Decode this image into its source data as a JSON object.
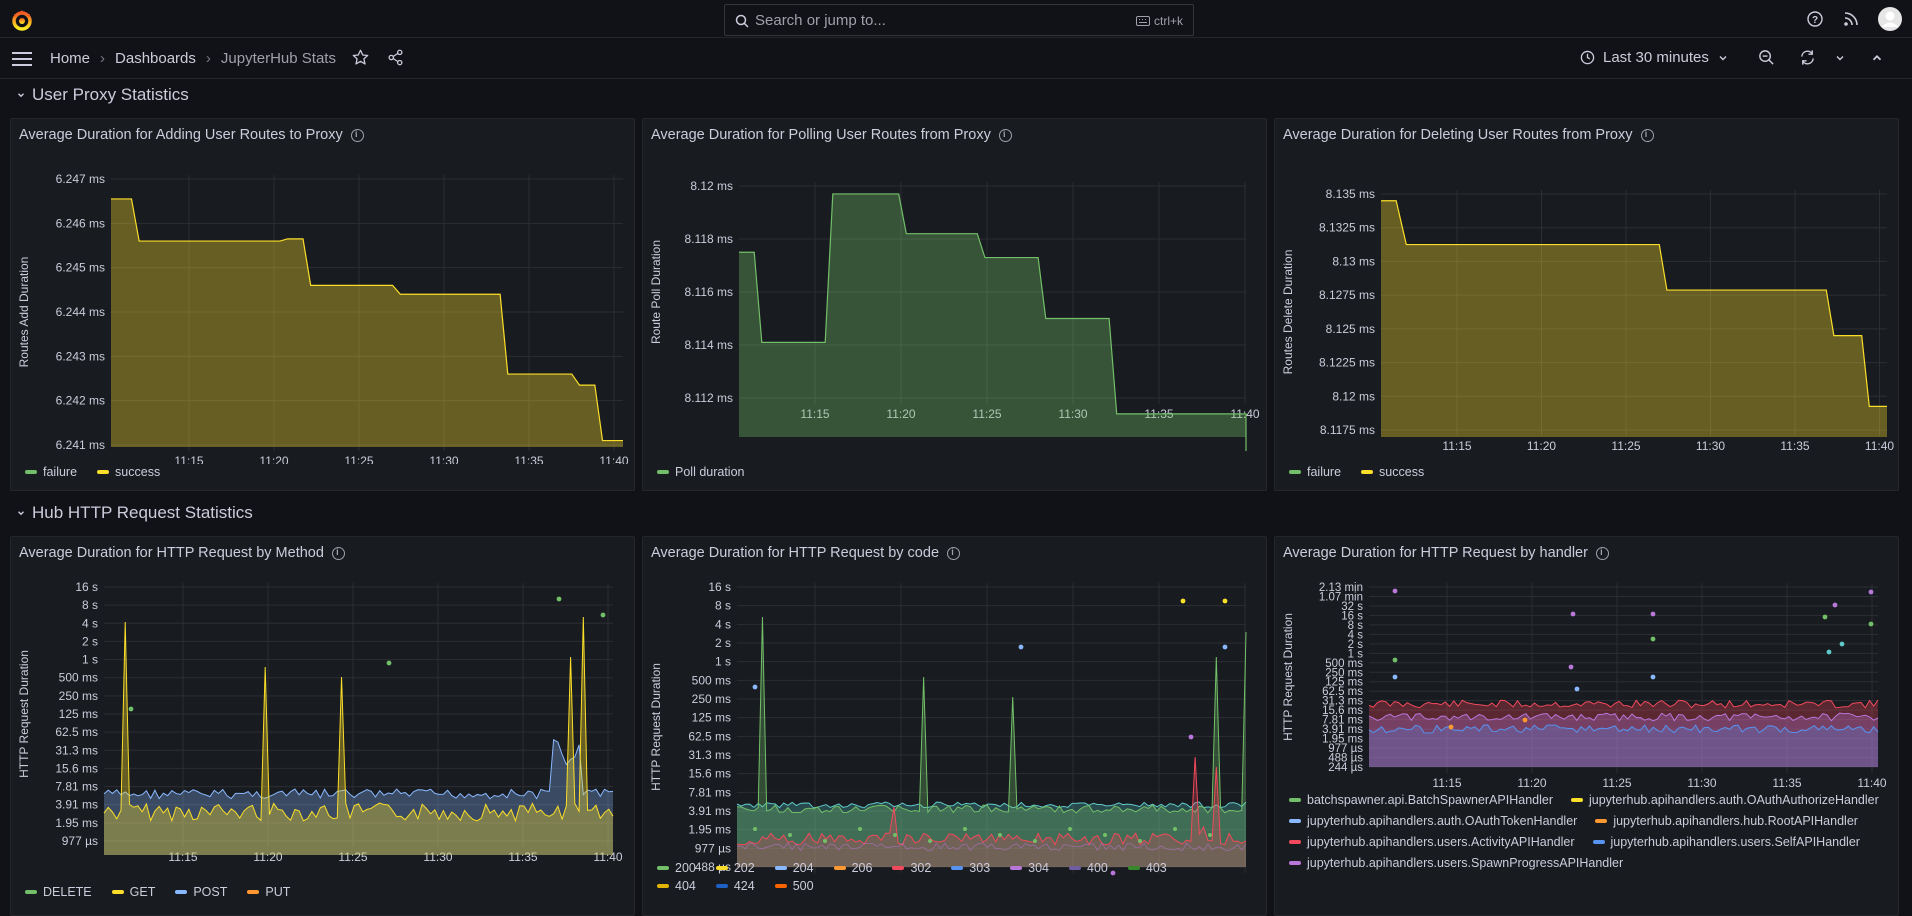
{
  "search": {
    "placeholder": "Search or jump to...",
    "shortcut": "ctrl+k"
  },
  "breadcrumb": [
    "Home",
    "Dashboards",
    "JupyterHub Stats"
  ],
  "timepicker": {
    "label": "Last 30 minutes"
  },
  "rows": {
    "proxy": "User Proxy Statistics",
    "http": "Hub HTTP Request Statistics"
  },
  "xticks": [
    "11:15",
    "11:20",
    "11:25",
    "11:30",
    "11:35",
    "11:40"
  ],
  "colors": {
    "green": "#73bf69",
    "yellow": "#fade2a",
    "blue": "#8ab8ff",
    "orange": "#ff9830",
    "red": "#f2495c",
    "blue2": "#5794f2",
    "purple": "#b877d9",
    "violet": "#8f3bb8",
    "dgreen": "#37872d",
    "dblue": "#1f60c4"
  },
  "panels": {
    "p1": {
      "title": "Average Duration for Adding User Routes to Proxy",
      "ylabel": "Routes Add Duration",
      "yticks": [
        "6.247 ms",
        "6.246 ms",
        "6.245 ms",
        "6.244 ms",
        "6.243 ms",
        "6.242 ms",
        "6.241 ms"
      ],
      "legend": [
        {
          "label": "failure",
          "color": "#73bf69"
        },
        {
          "label": "success",
          "color": "#fade2a"
        }
      ]
    },
    "p2": {
      "title": "Average Duration for Polling User Routes from Proxy",
      "ylabel": "Route Poll Duration",
      "yticks": [
        "8.12 ms",
        "8.118 ms",
        "8.116 ms",
        "8.114 ms",
        "8.112 ms"
      ],
      "legend": [
        {
          "label": "Poll duration",
          "color": "#73bf69"
        }
      ]
    },
    "p3": {
      "title": "Average Duration for Deleting User Routes from Proxy",
      "ylabel": "Routes Delete Duration",
      "yticks": [
        "8.135 ms",
        "8.1325 ms",
        "8.13 ms",
        "8.1275 ms",
        "8.125 ms",
        "8.1225 ms",
        "8.12 ms",
        "8.1175 ms"
      ],
      "legend": [
        {
          "label": "failure",
          "color": "#73bf69"
        },
        {
          "label": "success",
          "color": "#fade2a"
        }
      ]
    },
    "p4": {
      "title": "Average Duration for HTTP Request by Method",
      "ylabel": "HTTP Request Duration",
      "yticks": [
        "16 s",
        "8 s",
        "4 s",
        "2 s",
        "1 s",
        "500 ms",
        "250 ms",
        "125 ms",
        "62.5 ms",
        "31.3 ms",
        "15.6 ms",
        "7.81 ms",
        "3.91 ms",
        "1.95 ms",
        "977 µs"
      ],
      "legend": [
        {
          "label": "DELETE",
          "color": "#73bf69"
        },
        {
          "label": "GET",
          "color": "#fade2a"
        },
        {
          "label": "POST",
          "color": "#8ab8ff"
        },
        {
          "label": "PUT",
          "color": "#ff9830"
        }
      ]
    },
    "p5": {
      "title": "Average Duration for HTTP Request by code",
      "ylabel": "HTTP Request Duration",
      "yticks": [
        "16 s",
        "8 s",
        "4 s",
        "2 s",
        "1 s",
        "500 ms",
        "250 ms",
        "125 ms",
        "62.5 ms",
        "31.3 ms",
        "15.6 ms",
        "7.81 ms",
        "3.91 ms",
        "1.95 ms",
        "977 µs",
        "488 µs"
      ],
      "legend": [
        {
          "label": "200",
          "color": "#73bf69"
        },
        {
          "label": "202",
          "color": "#fade2a"
        },
        {
          "label": "204",
          "color": "#8ab8ff"
        },
        {
          "label": "206",
          "color": "#ff9830"
        },
        {
          "label": "302",
          "color": "#f2495c"
        },
        {
          "label": "303",
          "color": "#5794f2"
        },
        {
          "label": "304",
          "color": "#b877d9"
        },
        {
          "label": "400",
          "color": "#705da0"
        },
        {
          "label": "403",
          "color": "#37872d"
        },
        {
          "label": "404",
          "color": "#e0b400"
        },
        {
          "label": "424",
          "color": "#1f60c4"
        },
        {
          "label": "500",
          "color": "#fa6400"
        }
      ]
    },
    "p6": {
      "title": "Average Duration for HTTP Request by handler",
      "ylabel": "HTTP Request Duration",
      "yticks": [
        "2.13 min",
        "1.07 min",
        "32 s",
        "16 s",
        "8 s",
        "4 s",
        "2 s",
        "1 s",
        "500 ms",
        "250 ms",
        "125 ms",
        "62.5 ms",
        "31.3 ms",
        "15.6 ms",
        "7.81 ms",
        "3.91 ms",
        "1.95 ms",
        "977 µs",
        "488 µs",
        "244 µs"
      ],
      "legend": [
        {
          "label": "batchspawner.api.BatchSpawnerAPIHandler",
          "color": "#73bf69"
        },
        {
          "label": "jupyterhub.apihandlers.auth.OAuthAuthorizeHandler",
          "color": "#fade2a"
        },
        {
          "label": "jupyterhub.apihandlers.auth.OAuthTokenHandler",
          "color": "#8ab8ff"
        },
        {
          "label": "jupyterhub.apihandlers.hub.RootAPIHandler",
          "color": "#ff9830"
        },
        {
          "label": "jupyterhub.apihandlers.users.ActivityAPIHandler",
          "color": "#f2495c"
        },
        {
          "label": "jupyterhub.apihandlers.users.SelfAPIHandler",
          "color": "#5794f2"
        },
        {
          "label": "jupyterhub.apihandlers.users.SpawnProgressAPIHandler",
          "color": "#b877d9"
        }
      ]
    }
  }
}
